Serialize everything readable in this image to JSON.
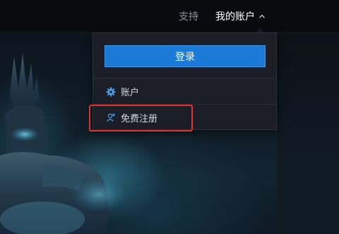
{
  "nav": {
    "support_label": "支持",
    "account_label": "我的账户",
    "account_chevron_icon": "chevron-up-icon"
  },
  "dropdown": {
    "login_label": "登录",
    "items": [
      {
        "label": "账户",
        "icon": "gear-icon"
      },
      {
        "label": "免费注册",
        "icon": "add-user-icon"
      }
    ]
  },
  "colors": {
    "primary_button": "#1a7ad6",
    "highlight_box": "#e2312f",
    "dropdown_bg": "#1b1e26",
    "nav_bg": "#0a0b0f"
  }
}
